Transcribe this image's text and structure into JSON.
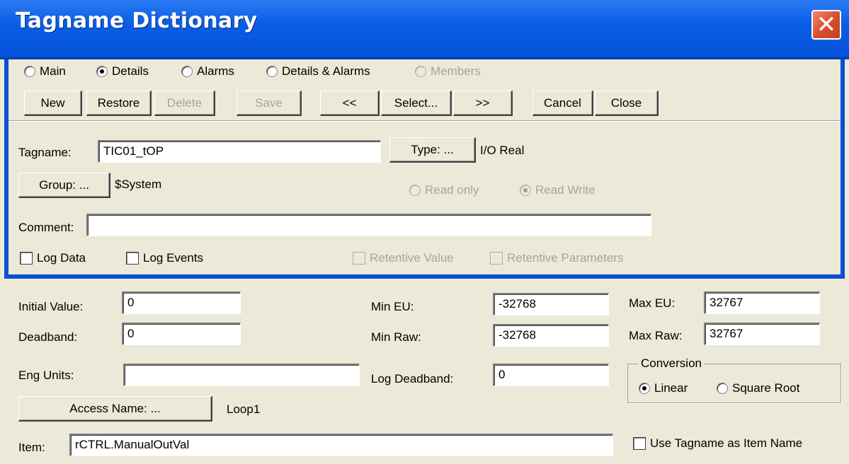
{
  "window": {
    "title": "Tagname Dictionary",
    "close_glyph": "✕"
  },
  "view_radios": [
    {
      "label": "Main",
      "checked": false,
      "enabled": true
    },
    {
      "label": "Details",
      "checked": true,
      "enabled": true
    },
    {
      "label": "Alarms",
      "checked": false,
      "enabled": true
    },
    {
      "label": "Details & Alarms",
      "checked": false,
      "enabled": true
    },
    {
      "label": "Members",
      "checked": false,
      "enabled": false
    }
  ],
  "toolbar": {
    "new": "New",
    "restore": "Restore",
    "delete": "Delete",
    "save": "Save",
    "prev": "<<",
    "select": "Select...",
    "next": ">>",
    "cancel": "Cancel",
    "close": "Close"
  },
  "tag": {
    "tagname_label": "Tagname:",
    "tagname_value": "TIC01_tOP",
    "type_button": "Type: ...",
    "type_value": "I/O Real",
    "group_button": "Group: ...",
    "group_value": "$System",
    "read_only": "Read only",
    "read_write": "Read Write",
    "comment_label": "Comment:",
    "comment_value": "",
    "log_data": "Log Data",
    "log_events": "Log Events",
    "retentive_value": "Retentive Value",
    "retentive_parameters": "Retentive Parameters"
  },
  "details": {
    "initial_value_label": "Initial Value:",
    "initial_value": "0",
    "deadband_label": "Deadband:",
    "deadband": "0",
    "eng_units_label": "Eng Units:",
    "eng_units": "",
    "min_eu_label": "Min EU:",
    "min_eu": "-32768",
    "min_raw_label": "Min Raw:",
    "min_raw": "-32768",
    "log_deadband_label": "Log Deadband:",
    "log_deadband": "0",
    "max_eu_label": "Max EU:",
    "max_eu": "32767",
    "max_raw_label": "Max Raw:",
    "max_raw": "32767",
    "conversion_title": "Conversion",
    "linear": "Linear",
    "square_root": "Square Root",
    "access_name_button": "Access Name: ...",
    "access_name_value": "Loop1",
    "item_label": "Item:",
    "item_value": "rCTRL.ManualOutVal",
    "use_tagname": "Use Tagname as Item Name"
  }
}
